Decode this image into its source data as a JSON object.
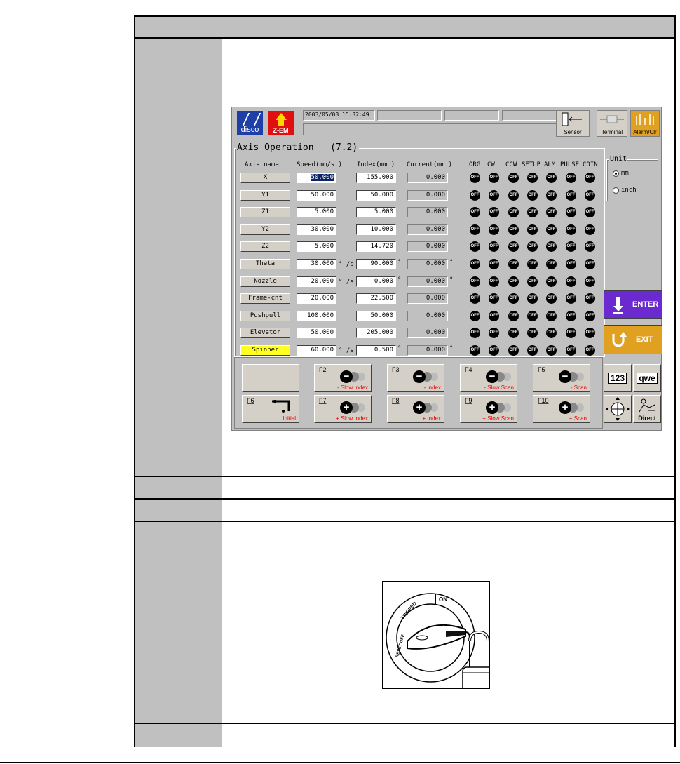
{
  "window": {
    "datetime": "2003/05/08 15:32:49",
    "logo_disco": "disco",
    "logo_zem": "Z-EM",
    "sensor_label": "Sensor",
    "terminal_label": "Terminal",
    "alarm_label": "Alarm/Clr"
  },
  "axis_panel": {
    "title": "Axis Operation",
    "version": "(7.2)",
    "headers": {
      "axis_name": "Axis name",
      "speed": "Speed(mm/s  )",
      "index": "Index(mm  )",
      "current": "Current(mm  )",
      "leds": [
        "ORG",
        "CW",
        "CCW",
        "SETUP",
        "ALM",
        "PULSE",
        "COIN"
      ]
    },
    "rows": [
      {
        "name": "X",
        "speed": "50.000",
        "index": "155.000",
        "current": "0.000",
        "speed_unit": "",
        "index_unit": "",
        "current_unit": "",
        "selected": false
      },
      {
        "name": "Y1",
        "speed": "50.000",
        "index": "50.000",
        "current": "0.000",
        "speed_unit": "",
        "index_unit": "",
        "current_unit": "",
        "selected": false
      },
      {
        "name": "Z1",
        "speed": "5.000",
        "index": "5.000",
        "current": "0.000",
        "speed_unit": "",
        "index_unit": "",
        "current_unit": "",
        "selected": false
      },
      {
        "name": "Y2",
        "speed": "30.000",
        "index": "10.000",
        "current": "0.000",
        "speed_unit": "",
        "index_unit": "",
        "current_unit": "",
        "selected": false
      },
      {
        "name": "Z2",
        "speed": "5.000",
        "index": "14.720",
        "current": "0.000",
        "speed_unit": "",
        "index_unit": "",
        "current_unit": "",
        "selected": false
      },
      {
        "name": "Theta",
        "speed": "30.000",
        "index": "90.000",
        "current": "0.000",
        "speed_unit": "° /s",
        "index_unit": "°",
        "current_unit": "°",
        "selected": false
      },
      {
        "name": "Nozzle",
        "speed": "20.000",
        "index": "0.000",
        "current": "0.000",
        "speed_unit": "° /s",
        "index_unit": "°",
        "current_unit": "°",
        "selected": false
      },
      {
        "name": "Frame-cnt",
        "speed": "20.000",
        "index": "22.500",
        "current": "0.000",
        "speed_unit": "",
        "index_unit": "",
        "current_unit": "",
        "selected": false
      },
      {
        "name": "Pushpull",
        "speed": "100.000",
        "index": "50.000",
        "current": "0.000",
        "speed_unit": "",
        "index_unit": "",
        "current_unit": "",
        "selected": false
      },
      {
        "name": "Elevator",
        "speed": "50.000",
        "index": "205.000",
        "current": "0.000",
        "speed_unit": "",
        "index_unit": "",
        "current_unit": "",
        "selected": false
      },
      {
        "name": "Spinner",
        "speed": "60.000",
        "index": "0.500",
        "current": "0.000",
        "speed_unit": "° /s",
        "index_unit": "°",
        "current_unit": "°",
        "selected": true
      }
    ],
    "led_text": "OFF"
  },
  "unit": {
    "title": "Unit",
    "options": [
      "mm",
      "inch"
    ],
    "selected": "mm"
  },
  "enter_label": "ENTER",
  "exit_label": "EXIT",
  "function_keys": [
    {
      "key": "F2",
      "label": "- Slow Index",
      "sign": "−"
    },
    {
      "key": "F3",
      "label": "- Index",
      "sign": "−"
    },
    {
      "key": "F4",
      "label": "- Slow Scan",
      "sign": "−"
    },
    {
      "key": "F5",
      "label": "- Scan",
      "sign": "−"
    },
    {
      "key": "F6",
      "label": "Initial",
      "sign": ""
    },
    {
      "key": "F7",
      "label": "+ Slow Index",
      "sign": "+"
    },
    {
      "key": "F8",
      "label": "+ Index",
      "sign": "+"
    },
    {
      "key": "F9",
      "label": "+ Slow Scan",
      "sign": "+"
    },
    {
      "key": "F10",
      "label": "+ Scan",
      "sign": "+"
    }
  ],
  "keypad": {
    "numeric": "123",
    "alpha": "qwe",
    "direct": "Direct"
  },
  "breaker": {
    "on": "ON",
    "tripped": "TRIPPED",
    "reset_off": "RESET OFF"
  }
}
